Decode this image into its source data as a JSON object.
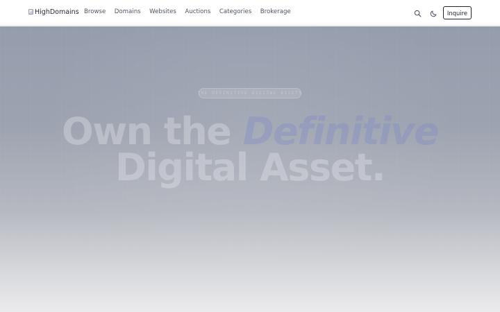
{
  "nav": {
    "logo_text": "HighDomains",
    "items": [
      {
        "label": "Browse"
      },
      {
        "label": "Domains"
      },
      {
        "label": "Websites"
      },
      {
        "label": "Auctions"
      },
      {
        "label": "Categories"
      },
      {
        "label": "Brokerage"
      }
    ],
    "icons": [
      "search-icon",
      "moon-icon"
    ],
    "cta_label": "Inquire"
  },
  "hero": {
    "badge": "THE DEFINITIVE DIGITAL ASSETS",
    "headline_line1_a": "Own the",
    "headline_line1_b": "Definitive",
    "headline_line2": "Digital Asset."
  }
}
